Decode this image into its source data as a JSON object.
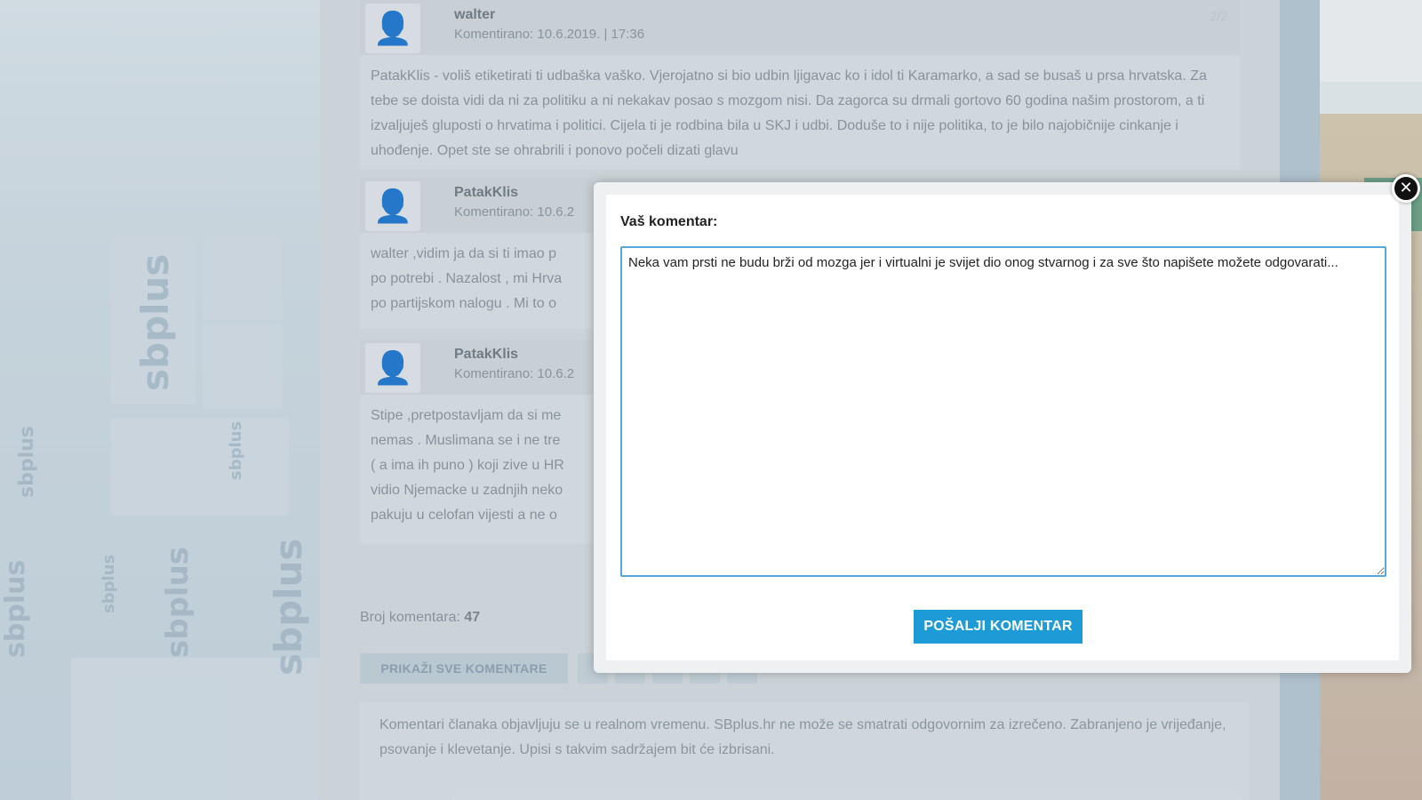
{
  "background": {
    "watermark_text": "sbplus",
    "comments": [
      {
        "author": "walter",
        "date": "Komentirano: 10.6.2019. | 17:36",
        "badge": "2/2",
        "avatar_icon": "user-avatar-icon",
        "body": "PatakKlis - voliš etiketirati ti udbaška vaško. Vjerojatno si bio udbin ljigavac ko i idol ti Karamarko, a sad se busaš u prsa hrvatska. Za tebe se doista vidi da ni za politiku a ni nekakav posao s mozgom nisi. Da zagorca su drmali gortovo 60 godina našim prostorom, a ti izvaljuješ gluposti o hrvatima i politici. Cijela ti je rodbina bila u SKJ i udbi. Doduše to i nije politika, to je bilo najobičnije cinkanje i uhođenje. Opet ste se ohrabrili i ponovo počeli dizati glavu"
      },
      {
        "author": "PatakKlis",
        "date": "Komentirano: 10.6.2",
        "badge": "",
        "avatar_icon": "user-avatar-icon",
        "body": "walter ,vidim ja da si ti imao p po potrebi . Nazalost , mi Hrva po partijskom nalogu . Mi to o"
      },
      {
        "author": "PatakKlis",
        "date": "Komentirano: 10.6.2",
        "badge": "",
        "avatar_icon": "user-avatar-icon",
        "body": "Stipe ,pretpostavljam da si me nemas . Muslimana se i ne tre ( a ima ih puno ) koji zive u HR vidio Njemacke u zadnjih neko pakuju u celofan vijesti a ne o"
      }
    ],
    "count_label": "Broj komentara:",
    "count_value": "47",
    "show_all_label": "PRIKAŽI SVE KOMENTARE",
    "disclaimer": "Komentari članaka objavljuju se u realnom vremenu. SBplus.hr ne može se smatrati odgovornim za izrečeno. Zabranjeno je vrijeđanje, psovanje i klevetanje. Upisi s takvim sadržajem bit će izbrisani."
  },
  "modal": {
    "label": "Vaš komentar:",
    "textarea_value": "Neka vam prsti ne budu brži od mozga jer i virtualni je svijet dio onog stvarnog i za sve što napišete možete odgovarati...",
    "submit_label": "POŠALJI KOMENTAR",
    "close_symbol": "✕",
    "close_icon": "close-icon"
  },
  "colors": {
    "accent": "#1c9bd6",
    "textarea_border": "#57a8d8"
  }
}
